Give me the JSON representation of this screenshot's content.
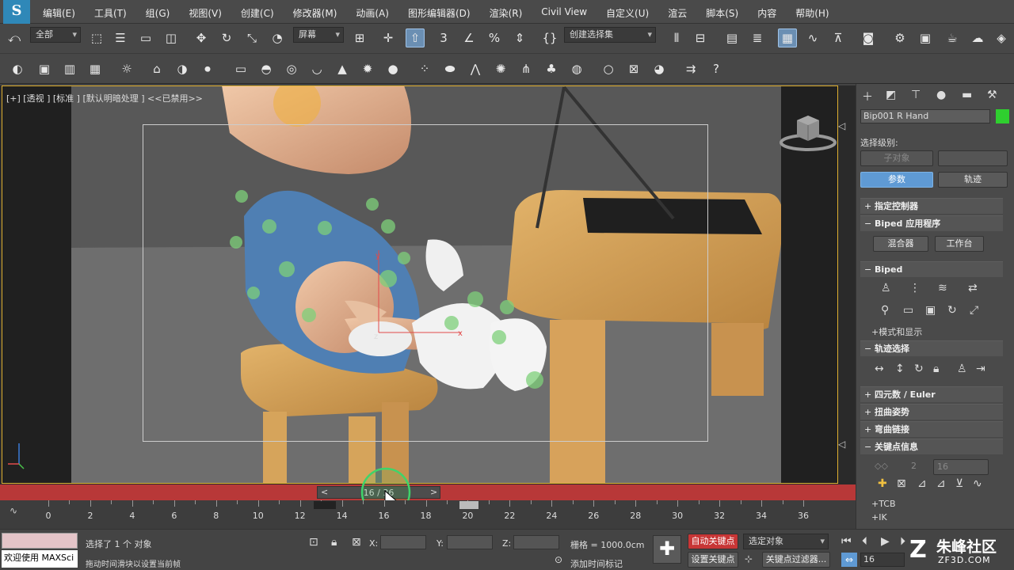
{
  "menubar": {
    "logo": "S",
    "items": [
      "编辑(E)",
      "工具(T)",
      "组(G)",
      "视图(V)",
      "创建(C)",
      "修改器(M)",
      "动画(A)",
      "图形编辑器(D)",
      "渲染(R)",
      "Civil View",
      "自定义(U)",
      "渲云",
      "脚本(S)",
      "内容",
      "帮助(H)"
    ]
  },
  "toolbar": {
    "filter": "全部",
    "ref_coord": "屏幕",
    "selection_set": "创建选择集"
  },
  "viewport": {
    "label": "[+] [透视 ] [标准 ] [默认明暗处理 ]  <<已禁用>>",
    "colors": {
      "active_border": "#e0b030",
      "timebar": "#b83838",
      "accent": "#5f9ad4"
    }
  },
  "timeline": {
    "slider_label": "16 / 36",
    "prev": "<",
    "next": ">",
    "ticks": [
      "0",
      "2",
      "4",
      "6",
      "8",
      "10",
      "12",
      "14",
      "16",
      "18",
      "20",
      "22",
      "24",
      "26",
      "28",
      "30",
      "32",
      "34",
      "36"
    ]
  },
  "panel": {
    "object_name": "Bip001 R Hand",
    "select_level": "选择级别:",
    "sub_object": "子对象",
    "params_btn": "参数",
    "track_btn": "轨迹",
    "rollouts": {
      "assign": "指定控制器",
      "biped_apps": "Biped 应用程序",
      "mixer": "混合器",
      "workbench": "工作台",
      "biped": "Biped",
      "mode_display": "+模式和显示",
      "track_select": "轨迹选择",
      "quat": "四元数 / Euler",
      "twist": "扭曲姿势",
      "bend": "弯曲链接",
      "key_info": "关键点信息",
      "tcb": "+TCB",
      "ik": "+IK",
      "key_num": "2",
      "key_frame": "16"
    }
  },
  "status": {
    "script_prompt": "欢迎使用 MAXSci",
    "selected": "选择了 1 个 对象",
    "hint": "拖动时间滑块以设置当前帧",
    "x_label": "X:",
    "y_label": "Y:",
    "z_label": "Z:",
    "grid": "栅格 = 1000.0cm",
    "add_tag": "添加时间标记",
    "auto_key": "自动关键点",
    "set_key": "设置关键点",
    "select_object": "选定对象",
    "key_filter": "关键点过滤器...",
    "frame": "16",
    "watermark": "朱峰社区",
    "watermark_url": "ZF3D.COM"
  }
}
